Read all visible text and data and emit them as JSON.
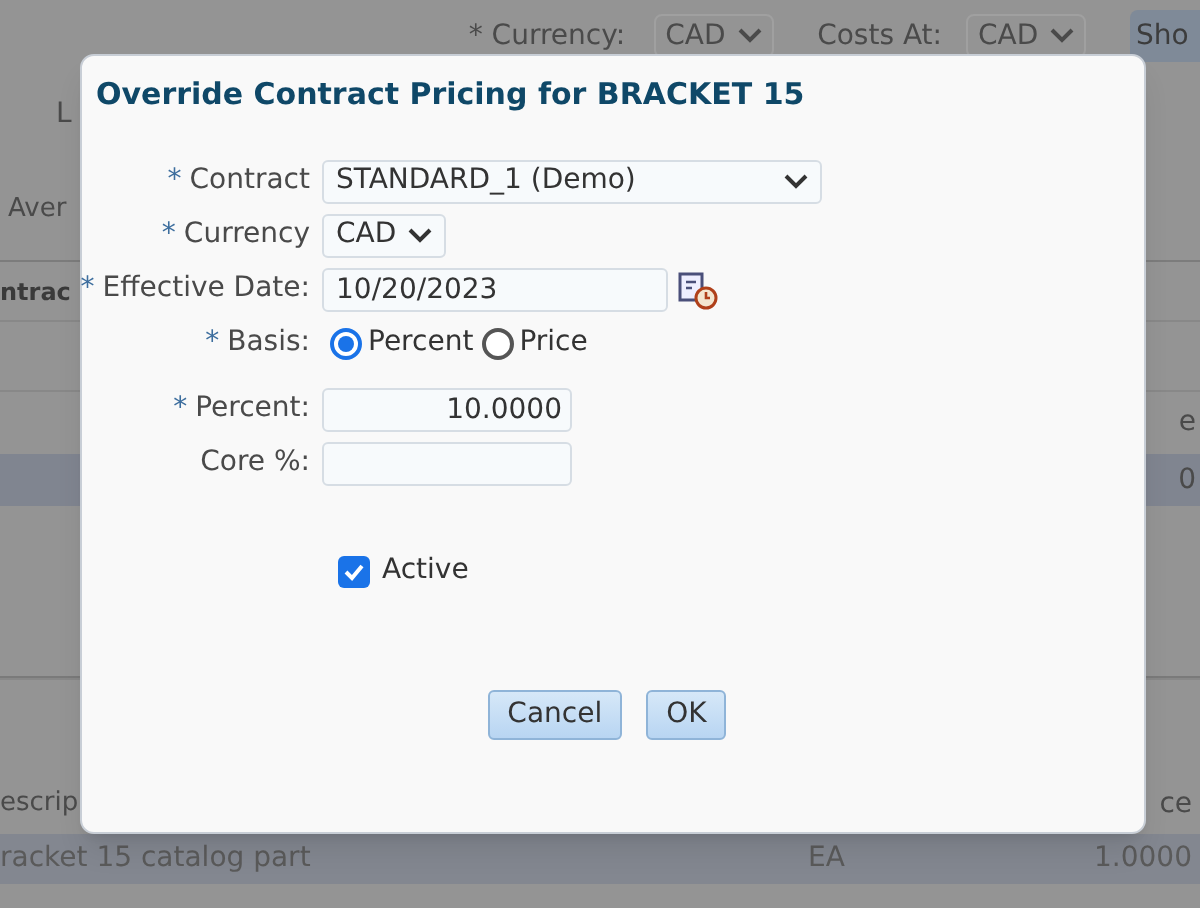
{
  "background": {
    "currency_label": "* Currency:",
    "currency_value": "CAD",
    "costs_at_label": "Costs At:",
    "costs_at_value": "CAD",
    "show_button": "Sho",
    "text_1": "L",
    "text_2": "Aver",
    "section_title": "ntrac",
    "column_1_header": "e",
    "row_1_value": "0",
    "description_header": "escrip",
    "price_header": "ce",
    "row_description": "racket 15 catalog part",
    "row_unit": "EA",
    "row_price": "1.0000"
  },
  "dialog": {
    "title": "Override Contract Pricing for BRACKET 15",
    "fields": [
      {
        "kind": "dropdown",
        "marker": "*",
        "label": "Contract",
        "value": "STANDARD_1 (Demo)"
      },
      {
        "kind": "small_dropdown",
        "marker": "*",
        "label": "Currency",
        "value": "CAD"
      },
      {
        "kind": "date",
        "marker": "*",
        "label": "Effective Date:",
        "value": "10/20/2023"
      },
      {
        "kind": "radio",
        "marker": "*",
        "label": "Basis:",
        "options": [
          {
            "label": "Percent",
            "selected": true
          },
          {
            "label": "Price",
            "selected": false
          }
        ]
      },
      {
        "kind": "number",
        "marker": "*",
        "label": "Percent:",
        "value": "10.0000"
      },
      {
        "kind": "number",
        "label": "Core %:"
      }
    ],
    "active": {
      "label": "Active",
      "checked": true
    },
    "buttons": [
      "Cancel",
      "OK"
    ]
  }
}
